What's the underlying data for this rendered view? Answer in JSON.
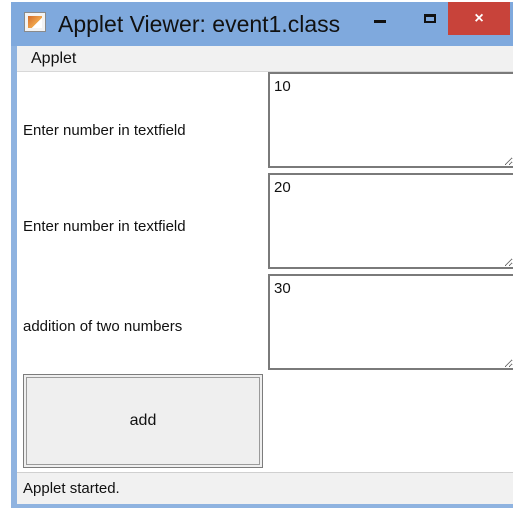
{
  "window": {
    "title": "Applet Viewer: event1.class",
    "minimize_glyph": "",
    "close_glyph": "×"
  },
  "menubar": {
    "items": [
      {
        "label": "Applet"
      }
    ]
  },
  "form": {
    "rows": [
      {
        "label": "Enter number in textfield",
        "value": "10"
      },
      {
        "label": "Enter number in textfield",
        "value": "20"
      },
      {
        "label": "addition of two numbers",
        "value": "30"
      }
    ],
    "add_label": "add"
  },
  "status": {
    "text": "Applet started."
  },
  "colors": {
    "titlebar": "#7fa9dd",
    "close_button": "#c8433a",
    "frame": "#8fb3e0"
  }
}
